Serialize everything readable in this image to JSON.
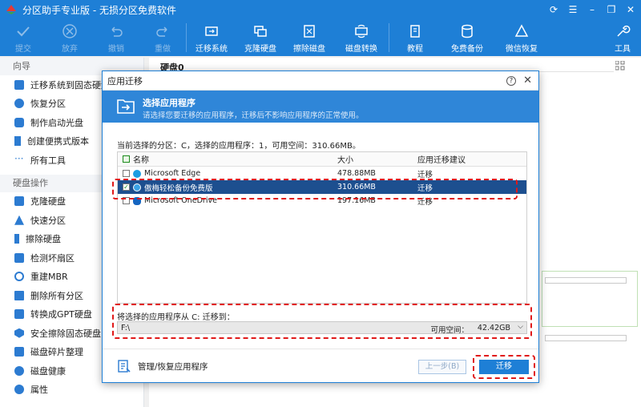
{
  "app": {
    "title": "分区助手专业版 - 无损分区免费软件"
  },
  "toolbar": {
    "items": [
      {
        "label": "提交",
        "icon": "check-icon",
        "enabled": false
      },
      {
        "label": "放弃",
        "icon": "discard-icon",
        "enabled": false
      },
      {
        "label": "撤销",
        "icon": "undo-icon",
        "enabled": false
      },
      {
        "label": "重做",
        "icon": "redo-icon",
        "enabled": false
      },
      {
        "label": "迁移系统",
        "icon": "migrate-os-icon",
        "enabled": true
      },
      {
        "label": "克隆硬盘",
        "icon": "clone-disk-icon",
        "enabled": true
      },
      {
        "label": "擦除磁盘",
        "icon": "wipe-disk-icon",
        "enabled": true
      },
      {
        "label": "磁盘转换",
        "icon": "convert-disk-icon",
        "enabled": true
      },
      {
        "label": "教程",
        "icon": "tutorial-icon",
        "enabled": true
      },
      {
        "label": "免费备份",
        "icon": "backup-icon",
        "enabled": true
      },
      {
        "label": "微信恢复",
        "icon": "recover-icon",
        "enabled": true
      },
      {
        "label": "工具",
        "icon": "tools-icon",
        "enabled": true
      }
    ]
  },
  "sidebar": {
    "wizard_header": "向导",
    "wizard_items": [
      {
        "label": "迁移系统到固态硬盘",
        "icon": "migrate-icon"
      },
      {
        "label": "恢复分区",
        "icon": "restore-icon"
      },
      {
        "label": "制作启动光盘",
        "icon": "bootdisk-icon"
      },
      {
        "label": "创建便携式版本",
        "icon": "portable-icon"
      },
      {
        "label": "所有工具",
        "icon": "more-icon"
      }
    ],
    "disk_header": "硬盘操作",
    "disk_items": [
      {
        "label": "克隆硬盘",
        "icon": "clone-icon"
      },
      {
        "label": "快速分区",
        "icon": "quick-partition-icon"
      },
      {
        "label": "擦除硬盘",
        "icon": "wipe-icon"
      },
      {
        "label": "检测坏扇区",
        "icon": "scan-icon"
      },
      {
        "label": "重建MBR",
        "icon": "mbr-icon"
      },
      {
        "label": "删除所有分区",
        "icon": "delete-icon"
      },
      {
        "label": "转换成GPT硬盘",
        "icon": "gpt-icon"
      },
      {
        "label": "安全擦除固态硬盘",
        "icon": "secure-erase-icon"
      },
      {
        "label": "磁盘碎片整理",
        "icon": "defrag-icon"
      },
      {
        "label": "磁盘健康",
        "icon": "health-icon"
      },
      {
        "label": "属性",
        "icon": "info-icon"
      }
    ]
  },
  "main": {
    "disk_label": "硬盘0"
  },
  "dialog": {
    "title": "应用迁移",
    "heading": "选择应用程序",
    "subheading": "请选择您要迁移的应用程序，迁移后不影响应用程序的正常使用。",
    "info": "当前选择的分区：C，选择的应用程序：1，可用空间：310.66MB。",
    "columns": {
      "name": "名称",
      "size": "大小",
      "advice": "应用迁移建议"
    },
    "apps": [
      {
        "name": "Microsoft Edge",
        "size": "478.88MB",
        "advice": "迁移",
        "checked": false,
        "selected": false,
        "icon_color": "#1b9de2"
      },
      {
        "name": "傲梅轻松备份免费版",
        "size": "310.66MB",
        "advice": "迁移",
        "checked": true,
        "selected": true,
        "icon_color": "#3ba3e6"
      },
      {
        "name": "Microsoft OneDrive",
        "size": "197.16MB",
        "advice": "迁移",
        "checked": false,
        "selected": false,
        "icon_color": "#1565c0"
      }
    ],
    "target_label": "将选择的应用程序从 C: 迁移到：",
    "target_value": "F:\\",
    "free_label": "可用空间：",
    "free_value": "42.42GB",
    "manage_label": "管理/恢复应用程序",
    "back_label": "上一步(B)",
    "go_label": "迁移"
  },
  "colors": {
    "accent": "#1e7fd6",
    "highlight_dash": "#e01919",
    "selected_row": "#1d4f8f"
  }
}
